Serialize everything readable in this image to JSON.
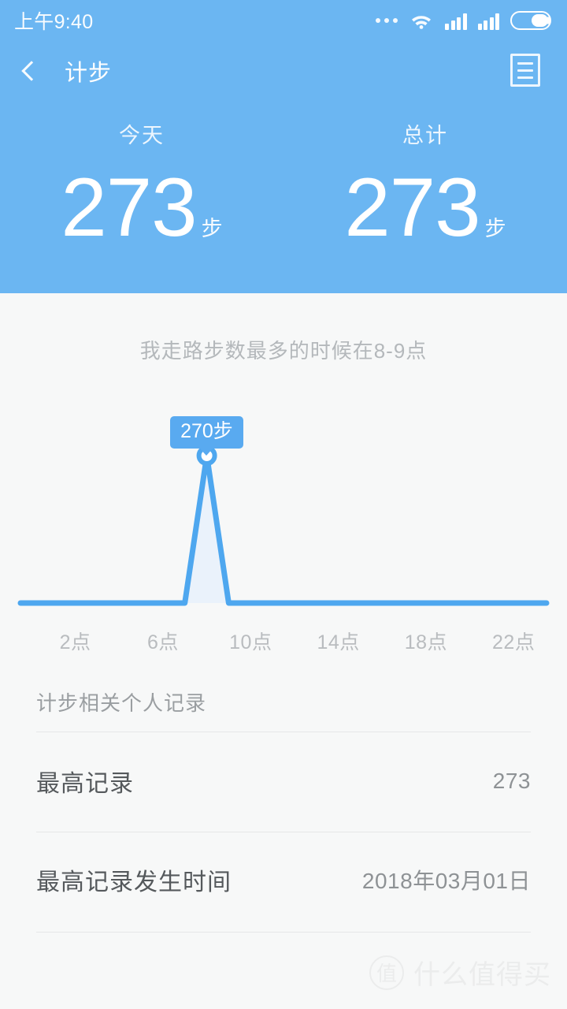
{
  "status_bar": {
    "time": "上午9:40",
    "icons": [
      "more-dots-icon",
      "wifi-icon",
      "signal-icon",
      "signal-icon",
      "battery-icon"
    ]
  },
  "nav": {
    "back_icon": "chevron-left-icon",
    "title": "计步",
    "menu_icon": "list-records-icon"
  },
  "stats": [
    {
      "label": "今天",
      "value": "273",
      "unit": "步"
    },
    {
      "label": "总计",
      "value": "273",
      "unit": "步"
    }
  ],
  "insight": "我走路步数最多的时候在8-9点",
  "chart_data": {
    "type": "area",
    "title": "",
    "subtitle": "我走路步数最多的时候在8-9点",
    "xlabel": "",
    "ylabel": "",
    "tooltip_label": "270步",
    "tooltip_value": 270,
    "peak_hour": 8,
    "tick_labels": [
      "2点",
      "6点",
      "10点",
      "14点",
      "18点",
      "22点"
    ],
    "tick_hours": [
      2,
      6,
      10,
      14,
      18,
      22
    ],
    "x": [
      0,
      1,
      2,
      3,
      4,
      5,
      6,
      7,
      8,
      9,
      10,
      11,
      12,
      13,
      14,
      15,
      16,
      17,
      18,
      19,
      20,
      21,
      22,
      23
    ],
    "values": [
      0,
      0,
      0,
      0,
      0,
      0,
      0,
      0,
      270,
      0,
      0,
      0,
      0,
      0,
      0,
      0,
      0,
      0,
      0,
      0,
      0,
      0,
      0,
      0
    ],
    "ylim": [
      0,
      300
    ],
    "grid": false,
    "legend": false,
    "line_color": "#4ea7ef",
    "fill_color": "#eaf2fb"
  },
  "records": {
    "section_title": "计步相关个人记录",
    "rows": [
      {
        "key": "最高记录",
        "value": "273"
      },
      {
        "key": "最高记录发生时间",
        "value": "2018年03月01日"
      }
    ]
  },
  "watermark": {
    "badge": "值",
    "text": "什么值得买"
  },
  "colors": {
    "header_blue": "#6bb6f2",
    "chart_blue": "#4ea7ef",
    "tooltip_blue": "#59aaf0",
    "page_bg": "#f7f8f8"
  }
}
